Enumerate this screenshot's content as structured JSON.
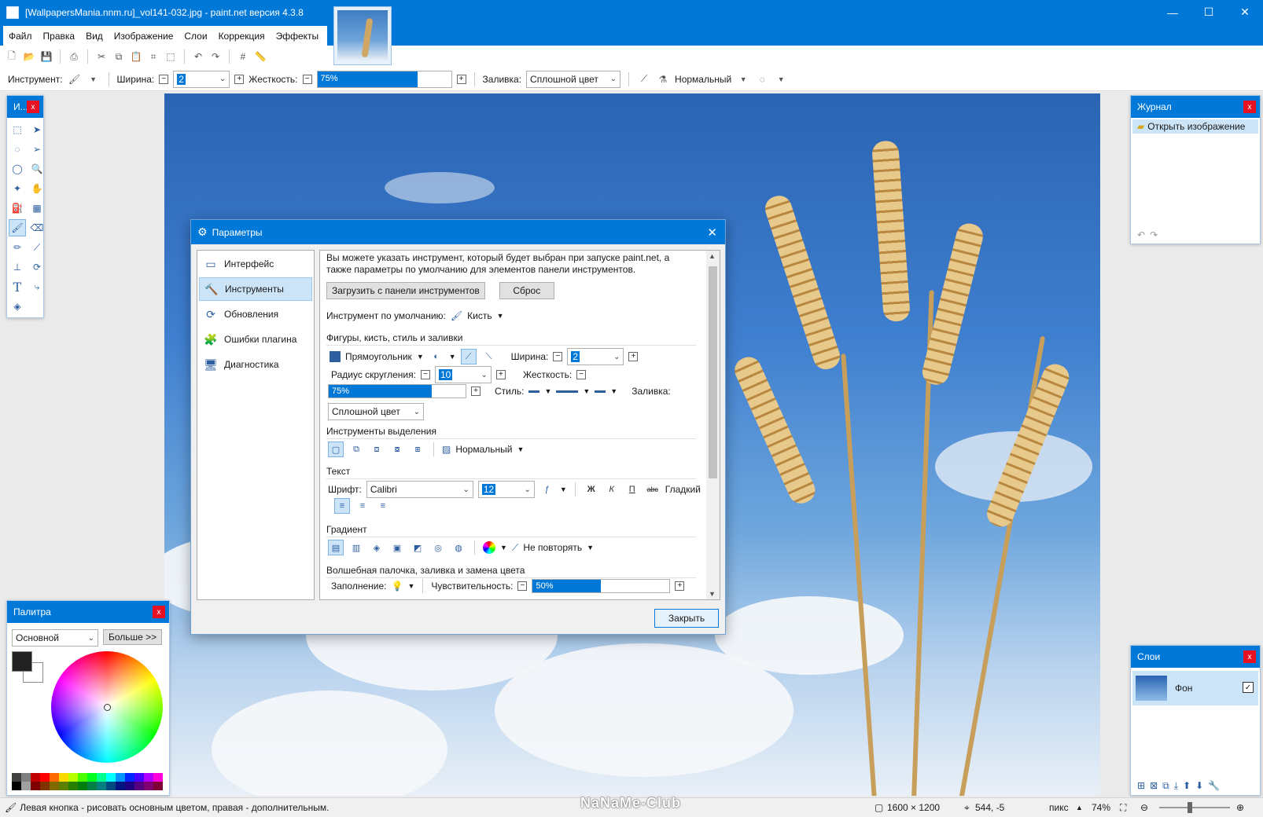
{
  "window": {
    "title": "[WallpapersMania.nnm.ru]_vol141-032.jpg - paint.net версия 4.3.8",
    "minimize": "—",
    "maximize": "☐",
    "close": "✕"
  },
  "menu": [
    "Файл",
    "Правка",
    "Вид",
    "Изображение",
    "Слои",
    "Коррекция",
    "Эффекты"
  ],
  "toolbar": {
    "tool_label": "Инструмент:",
    "width_label": "Ширина:",
    "width_value": "2",
    "hardness_label": "Жесткость:",
    "hardness_value": "75%",
    "hardness_percent": 75,
    "fill_label": "Заливка:",
    "fill_value": "Сплошной цвет",
    "blend_value": "Нормальный"
  },
  "tools_panel": {
    "title": "И...",
    "close": "x",
    "tools": [
      "rect-select-icon",
      "move-selection-icon",
      "lasso-icon",
      "move-selected-icon",
      "ellipse-select-icon",
      "zoom-icon",
      "magic-wand-icon",
      "pan-icon",
      "paint-bucket-icon",
      "gradient-icon",
      "paintbrush-icon",
      "eraser-icon",
      "pencil-icon",
      "color-picker-icon",
      "clone-stamp-icon",
      "recolor-icon",
      "text-icon",
      "line-curve-icon",
      "shapes-icon"
    ]
  },
  "palette": {
    "title": "Палитра",
    "close": "x",
    "mode": "Основной",
    "more": "Больше >>",
    "primary_color": "#222222",
    "secondary_color": "#ffffff",
    "swatches": [
      "#404040",
      "#7f7f7f",
      "#c00000",
      "#ff0000",
      "#ff6a00",
      "#ffd800",
      "#b6ff00",
      "#4cff00",
      "#00ff21",
      "#00ff90",
      "#00ffff",
      "#0094ff",
      "#0026ff",
      "#4800ff",
      "#b200ff",
      "#ff00dc",
      "#000000",
      "#a0a0a0",
      "#7f0000",
      "#7f3300",
      "#7f6a00",
      "#5b7f00",
      "#267f00",
      "#007f0e",
      "#007f46",
      "#007f7f",
      "#004a7f",
      "#00137f",
      "#21007f",
      "#57007f",
      "#7f006e",
      "#7f0037"
    ]
  },
  "history": {
    "title": "Журнал",
    "close": "x",
    "item": "Открыть изображение",
    "undo": "↶",
    "redo": "↷"
  },
  "layers": {
    "title": "Слои",
    "close": "x",
    "layer_name": "Фон",
    "checked": "✓"
  },
  "status": {
    "hint": "Левая кнопка - рисовать основным цветом, правая - дополнительным.",
    "size": "1600 × 1200",
    "coords": "544, -5",
    "unit": "пикс",
    "zoom": "74%"
  },
  "watermark": "NaNaMe-Club",
  "dialog": {
    "title": "Параметры",
    "close": "✕",
    "nav": [
      "Интерфейс",
      "Инструменты",
      "Обновления",
      "Ошибки плагина",
      "Диагностика"
    ],
    "active_nav": 1,
    "description": "Вы можете указать инструмент, который будет выбран при запуске paint.net, а также параметры по умолчанию для элементов панели инструментов.",
    "load_button": "Загрузить с панели инструментов",
    "reset_button": "Сброс",
    "default_tool_label": "Инструмент по умолчанию:",
    "default_tool_value": "Кисть",
    "shapes_section": "Фигуры, кисть, стиль и заливки",
    "shape_type": "Прямоугольник",
    "width_label": "Ширина:",
    "width_value": "2",
    "radius_label": "Радиус скругления:",
    "radius_value": "10",
    "hardness_label": "Жесткость:",
    "hardness_value": "75%",
    "hardness_percent": 75,
    "style_label": "Стиль:",
    "fill_label": "Заливка:",
    "fill_value": "Сплошной цвет",
    "selection_section": "Инструменты выделения",
    "selection_mode": "Нормальный",
    "text_section": "Текст",
    "font_label": "Шрифт:",
    "font_value": "Calibri",
    "font_size": "12",
    "bold": "Ж",
    "italic": "К",
    "underline": "П",
    "strike": "abc",
    "antialias": "Гладкий",
    "gradient_section": "Градиент",
    "gradient_repeat": "Не повторять",
    "wand_section": "Волшебная палочка, заливка и замена цвета",
    "flood_label": "Заполнение:",
    "sensitivity_label": "Чувствительность:",
    "sensitivity_value": "50%",
    "sensitivity_percent": 50,
    "close_button": "Закрыть"
  }
}
